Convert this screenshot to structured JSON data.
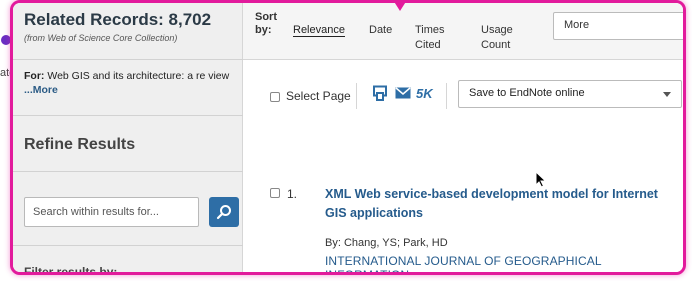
{
  "background": {
    "partial_text": "ate"
  },
  "sidebar": {
    "related_title": "Related Records: 8,702",
    "related_subtitle": "(from Web of Science Core Collection)",
    "for_label": "For:",
    "for_text": "Web GIS and its architecture: a re view",
    "more_link": "...More",
    "refine_title": "Refine Results",
    "search_placeholder": "Search within results for...",
    "filter_label": "Filter results by:"
  },
  "sort": {
    "label": "Sort by:",
    "options": [
      "Relevance",
      "Date",
      "Times Cited",
      "Usage Count"
    ],
    "active": "Relevance",
    "more_label": "More"
  },
  "toolbar": {
    "select_page_label": "Select Page",
    "count_label": "5K",
    "save_option": "Save to EndNote online",
    "icons": [
      "print-icon",
      "mail-icon"
    ]
  },
  "records": [
    {
      "number": "1.",
      "title": "XML Web service-based development model for Internet GIS applications",
      "authors": "By: Chang, YS; Park, HD",
      "journal": "INTERNATIONAL JOURNAL OF GEOGRAPHICAL INFORMATION"
    }
  ],
  "colors": {
    "highlight": "#e21a9c",
    "link": "#255b8c",
    "accent": "#2e6ea6"
  }
}
